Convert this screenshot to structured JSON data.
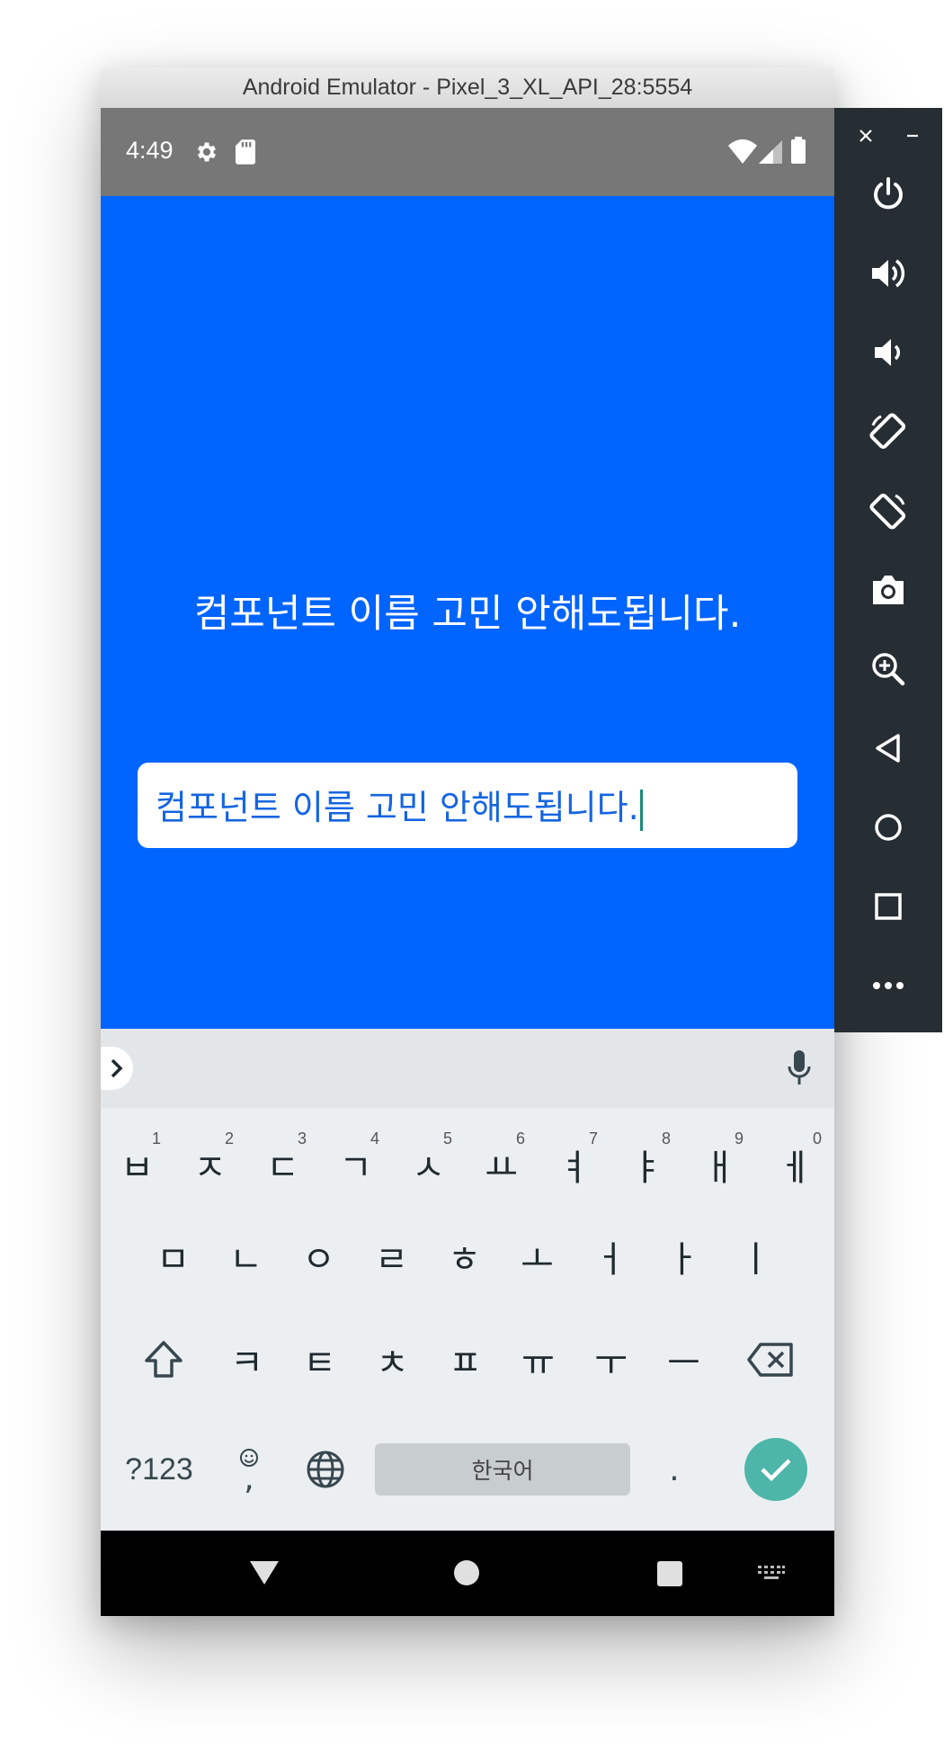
{
  "window": {
    "title": "Android Emulator - Pixel_3_XL_API_28:5554"
  },
  "status_bar": {
    "time": "4:49"
  },
  "app": {
    "heading": "컴포넌트 이름 고민 안해도됩니다.",
    "text_input": {
      "value": "컴포넌트 이름 고민 안해도됩니다."
    },
    "background_color": "#0064ff"
  },
  "keyboard": {
    "row1": [
      {
        "key": "ㅂ",
        "hint": "1"
      },
      {
        "key": "ㅈ",
        "hint": "2"
      },
      {
        "key": "ㄷ",
        "hint": "3"
      },
      {
        "key": "ㄱ",
        "hint": "4"
      },
      {
        "key": "ㅅ",
        "hint": "5"
      },
      {
        "key": "ㅛ",
        "hint": "6"
      },
      {
        "key": "ㅕ",
        "hint": "7"
      },
      {
        "key": "ㅑ",
        "hint": "8"
      },
      {
        "key": "ㅐ",
        "hint": "9"
      },
      {
        "key": "ㅔ",
        "hint": "0"
      }
    ],
    "row2": [
      "ㅁ",
      "ㄴ",
      "ㅇ",
      "ㄹ",
      "ㅎ",
      "ㅗ",
      "ㅓ",
      "ㅏ",
      "ㅣ"
    ],
    "row3": [
      "ㅋ",
      "ㅌ",
      "ㅊ",
      "ㅍ",
      "ㅠ",
      "ㅜ",
      "ㅡ"
    ],
    "symbols_label": "?123",
    "comma_label": ",",
    "space_label": "한국어",
    "period_label": ".",
    "accent_color": "#4db6a9"
  }
}
